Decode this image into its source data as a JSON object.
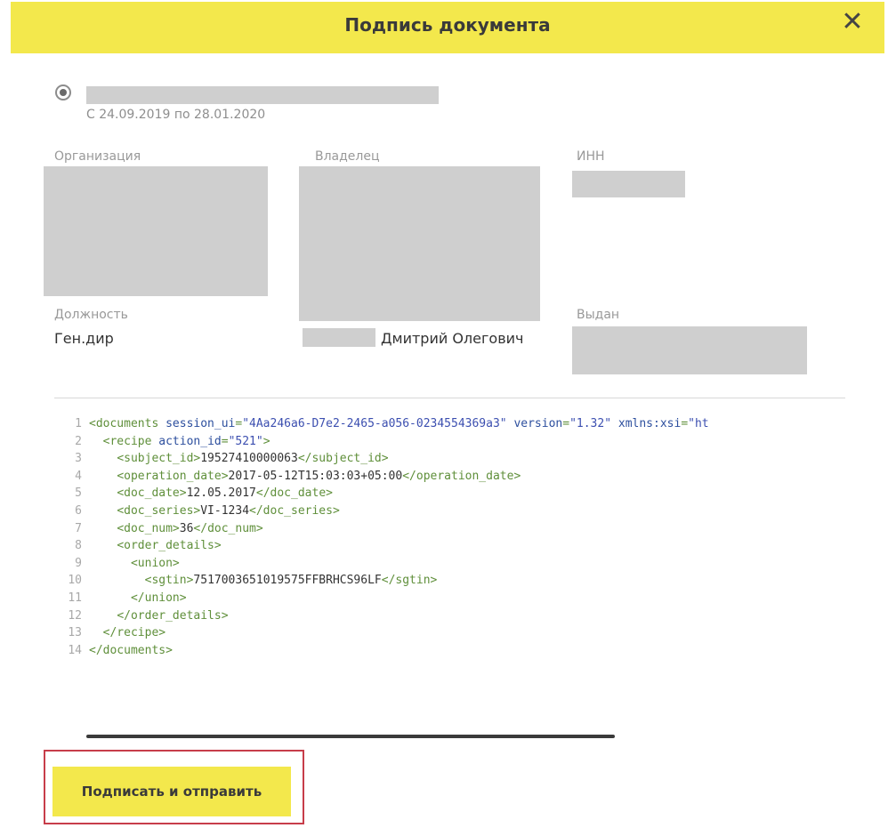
{
  "dialog": {
    "title": "Подпись документа",
    "close_icon": "close-icon"
  },
  "certificate": {
    "period": "С 24.09.2019 по 28.01.2020"
  },
  "fields": {
    "org_label": "Организация",
    "owner_label": "Владелец",
    "inn_label": "ИНН",
    "position_label": "Должность",
    "position_value": "Ген.дир",
    "owner_name_visible": "Дмитрий Олегович",
    "issued_label": "Выдан"
  },
  "xml_lines": [
    {
      "n": "1",
      "parts": [
        [
          "t",
          "<documents "
        ],
        [
          "a",
          "session_ui"
        ],
        [
          "t",
          "="
        ],
        [
          "s",
          "\"4Aa246a6-D7e2-2465-a056-0234554369a3\""
        ],
        [
          "t",
          " "
        ],
        [
          "a",
          "version"
        ],
        [
          "t",
          "="
        ],
        [
          "s",
          "\"1.32\""
        ],
        [
          "t",
          " "
        ],
        [
          "a",
          "xmlns:xsi"
        ],
        [
          "t",
          "="
        ],
        [
          "s",
          "\"ht"
        ]
      ]
    },
    {
      "n": "2",
      "parts": [
        [
          "x",
          "  "
        ],
        [
          "t",
          "<recipe "
        ],
        [
          "a",
          "action_id"
        ],
        [
          "t",
          "="
        ],
        [
          "s",
          "\"521\""
        ],
        [
          "t",
          ">"
        ]
      ]
    },
    {
      "n": "3",
      "parts": [
        [
          "x",
          "    "
        ],
        [
          "t",
          "<subject_id>"
        ],
        [
          "x",
          "19527410000063"
        ],
        [
          "t",
          "</subject_id>"
        ]
      ]
    },
    {
      "n": "4",
      "parts": [
        [
          "x",
          "    "
        ],
        [
          "t",
          "<operation_date>"
        ],
        [
          "x",
          "2017-05-12T15:03:03+05:00"
        ],
        [
          "t",
          "</operation_date>"
        ]
      ]
    },
    {
      "n": "5",
      "parts": [
        [
          "x",
          "    "
        ],
        [
          "t",
          "<doc_date>"
        ],
        [
          "x",
          "12.05.2017"
        ],
        [
          "t",
          "</doc_date>"
        ]
      ]
    },
    {
      "n": "6",
      "parts": [
        [
          "x",
          "    "
        ],
        [
          "t",
          "<doc_series>"
        ],
        [
          "x",
          "VI-1234"
        ],
        [
          "t",
          "</doc_series>"
        ]
      ]
    },
    {
      "n": "7",
      "parts": [
        [
          "x",
          "    "
        ],
        [
          "t",
          "<doc_num>"
        ],
        [
          "x",
          "36"
        ],
        [
          "t",
          "</doc_num>"
        ]
      ]
    },
    {
      "n": "8",
      "parts": [
        [
          "x",
          "    "
        ],
        [
          "t",
          "<order_details>"
        ]
      ]
    },
    {
      "n": "9",
      "parts": [
        [
          "x",
          "      "
        ],
        [
          "t",
          "<union>"
        ]
      ]
    },
    {
      "n": "10",
      "parts": [
        [
          "x",
          "        "
        ],
        [
          "t",
          "<sgtin>"
        ],
        [
          "x",
          "7517003651019575FFBRHCS96LF"
        ],
        [
          "t",
          "</sgtin>"
        ]
      ]
    },
    {
      "n": "11",
      "parts": [
        [
          "x",
          "      "
        ],
        [
          "t",
          "</union>"
        ]
      ]
    },
    {
      "n": "12",
      "parts": [
        [
          "x",
          "    "
        ],
        [
          "t",
          "</order_details>"
        ]
      ]
    },
    {
      "n": "13",
      "parts": [
        [
          "x",
          "  "
        ],
        [
          "t",
          "</recipe>"
        ]
      ]
    },
    {
      "n": "14",
      "parts": [
        [
          "t",
          "</documents>"
        ]
      ]
    }
  ],
  "actions": {
    "sign_send_label": "Подписать и отправить"
  },
  "colors": {
    "header": "#f3e84c",
    "button": "#f3e84c",
    "highlight_frame": "#c73d4a"
  }
}
